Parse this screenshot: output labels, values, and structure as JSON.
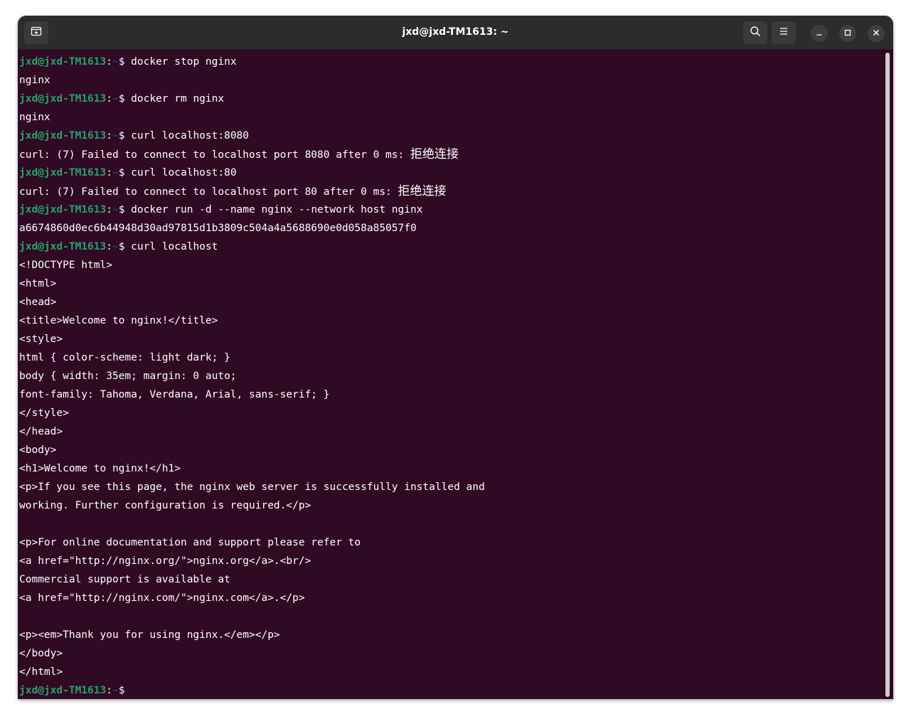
{
  "window": {
    "title": "jxd@jxd-TM1613: ~"
  },
  "icons": {
    "new_tab": "new-tab-icon",
    "search": "search-icon",
    "menu": "hamburger-menu-icon",
    "minimize": "minimize-icon",
    "maximize": "maximize-icon",
    "close": "close-icon"
  },
  "colors": {
    "terminal_bg": "#300a24",
    "prompt_user": "#26a269",
    "prompt_path": "#12488b",
    "text": "#ffffff"
  },
  "prompt": {
    "user_host": "jxd@jxd-TM1613",
    "colon": ":",
    "path": "~",
    "dollar": "$ "
  },
  "terminal": {
    "lines": [
      {
        "prompt": true,
        "text": "docker stop nginx"
      },
      {
        "prompt": false,
        "text": "nginx"
      },
      {
        "prompt": true,
        "text": "docker rm nginx"
      },
      {
        "prompt": false,
        "text": "nginx"
      },
      {
        "prompt": true,
        "text": "curl localhost:8080"
      },
      {
        "prompt": false,
        "text": "curl: (7) Failed to connect to localhost port 8080 after 0 ms: ",
        "cjk": "拒绝连接"
      },
      {
        "prompt": true,
        "text": "curl localhost:80"
      },
      {
        "prompt": false,
        "text": "curl: (7) Failed to connect to localhost port 80 after 0 ms: ",
        "cjk": "拒绝连接"
      },
      {
        "prompt": true,
        "text": "docker run -d --name nginx --network host nginx"
      },
      {
        "prompt": false,
        "text": "a6674860d0ec6b44948d30ad97815d1b3809c504a4a5688690e0d058a85057f0"
      },
      {
        "prompt": true,
        "text": "curl localhost"
      },
      {
        "prompt": false,
        "text": "<!DOCTYPE html>"
      },
      {
        "prompt": false,
        "text": "<html>"
      },
      {
        "prompt": false,
        "text": "<head>"
      },
      {
        "prompt": false,
        "text": "<title>Welcome to nginx!</title>"
      },
      {
        "prompt": false,
        "text": "<style>"
      },
      {
        "prompt": false,
        "text": "html { color-scheme: light dark; }"
      },
      {
        "prompt": false,
        "text": "body { width: 35em; margin: 0 auto;"
      },
      {
        "prompt": false,
        "text": "font-family: Tahoma, Verdana, Arial, sans-serif; }"
      },
      {
        "prompt": false,
        "text": "</style>"
      },
      {
        "prompt": false,
        "text": "</head>"
      },
      {
        "prompt": false,
        "text": "<body>"
      },
      {
        "prompt": false,
        "text": "<h1>Welcome to nginx!</h1>"
      },
      {
        "prompt": false,
        "text": "<p>If you see this page, the nginx web server is successfully installed and"
      },
      {
        "prompt": false,
        "text": "working. Further configuration is required.</p>"
      },
      {
        "prompt": false,
        "text": ""
      },
      {
        "prompt": false,
        "text": "<p>For online documentation and support please refer to"
      },
      {
        "prompt": false,
        "text": "<a href=\"http://nginx.org/\">nginx.org</a>.<br/>"
      },
      {
        "prompt": false,
        "text": "Commercial support is available at"
      },
      {
        "prompt": false,
        "text": "<a href=\"http://nginx.com/\">nginx.com</a>.</p>"
      },
      {
        "prompt": false,
        "text": ""
      },
      {
        "prompt": false,
        "text": "<p><em>Thank you for using nginx.</em></p>"
      },
      {
        "prompt": false,
        "text": "</body>"
      },
      {
        "prompt": false,
        "text": "</html>"
      },
      {
        "prompt": true,
        "text": ""
      }
    ]
  }
}
